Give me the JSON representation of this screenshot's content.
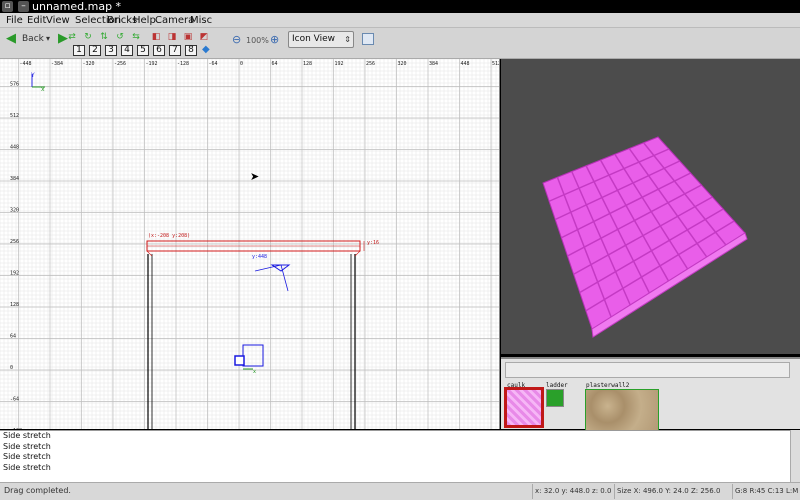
{
  "window": {
    "title": "unnamed.map *"
  },
  "menubar": {
    "items": [
      "File",
      "Edit",
      "View",
      "Selection",
      "Bricks",
      "Help",
      "Camera",
      "Misc"
    ]
  },
  "toolbar": {
    "back_label": "Back",
    "numbers": [
      "1",
      "2",
      "3",
      "4",
      "5",
      "6",
      "7",
      "8"
    ],
    "zoom": "100%",
    "view_mode": "Icon View"
  },
  "grid": {
    "x_ticks": [
      "-512",
      "-448",
      "-384",
      "-320",
      "-256",
      "-192",
      "-128",
      "-64",
      "0",
      "64",
      "128",
      "192",
      "256",
      "320",
      "384",
      "448",
      "512"
    ],
    "y_ticks": [
      "640",
      "576",
      "512",
      "448",
      "384",
      "320",
      "256",
      "192",
      "128",
      "64",
      "0",
      "-64",
      "-128"
    ],
    "axis_x": "x",
    "axis_y": "Y",
    "brush_label_coords": "(x:-208  y:208)",
    "brush_label_y": "y:16",
    "entity_label": "y:448",
    "origin_label": "x"
  },
  "textures": [
    {
      "name": "caulk",
      "selected": true
    },
    {
      "name": "ladder",
      "selected": false
    },
    {
      "name": "plasterwall2",
      "selected": false
    }
  ],
  "console": {
    "lines": [
      "Side stretch",
      "Side stretch",
      "Side stretch",
      "Side stretch"
    ]
  },
  "status": {
    "message": "Drag completed.",
    "coords": "x: 32.0  y: 448.0  z: 0.0",
    "size": "Size X: 496.0  Y: 24.0  Z: 256.0",
    "grid": "G:8 R:45 C:13 L:M"
  },
  "colors": {
    "brush_selected": "#d01818",
    "brush_outline": "#000000",
    "camera": "#1a1ae0",
    "face_3d": "#e95ee9",
    "grid_minor": "#e4e4e4",
    "grid_major": "#bdbdbd"
  }
}
